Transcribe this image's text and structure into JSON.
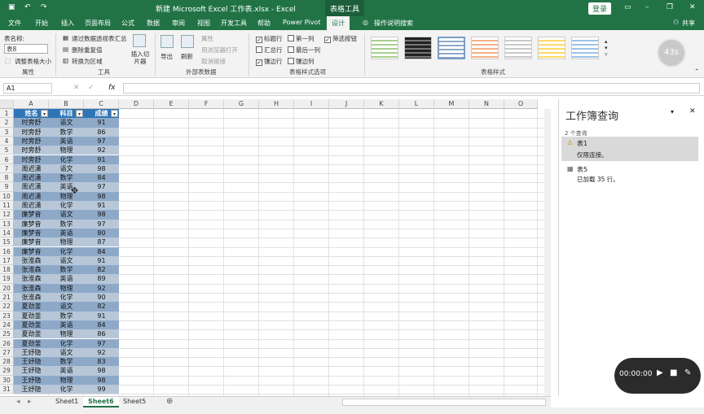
{
  "titlebar": {
    "title": "新建 Microsoft Excel 工作表.xlsx  -  Excel",
    "context": "表格工具",
    "login": "登录",
    "share": "共享"
  },
  "tabs": [
    "文件",
    "开始",
    "插入",
    "页面布局",
    "公式",
    "数据",
    "审阅",
    "视图",
    "开发工具",
    "帮助",
    "Power Pivot",
    "设计"
  ],
  "search_tab": "操作说明搜索",
  "ribbon": {
    "table_name_label": "表名称:",
    "table_name_value": "表8",
    "resize": "调整表格大小",
    "group_properties": "属性",
    "tools": [
      "通过数据透视表汇总",
      "删除重复值",
      "转换为区域"
    ],
    "insert_slicer": "插入切片器",
    "group_tools": "工具",
    "export": "导出",
    "refresh": "刷新",
    "ext_items": [
      "属性",
      "用浏览器打开",
      "取消链接"
    ],
    "group_external": "外部表数据",
    "options": [
      {
        "label": "标题行",
        "checked": true
      },
      {
        "label": "第一列",
        "checked": false
      },
      {
        "label": "筛选按钮",
        "checked": true
      },
      {
        "label": "汇总行",
        "checked": false
      },
      {
        "label": "最后一列",
        "checked": false
      },
      {
        "label": "镶边行",
        "checked": true
      },
      {
        "label": "镶边列",
        "checked": false
      }
    ],
    "group_options": "表格样式选项",
    "group_styles": "表格样式",
    "timer": "43s"
  },
  "formula": {
    "namebox": "A1",
    "fx": "fx"
  },
  "columns": [
    "A",
    "B",
    "C",
    "D",
    "E",
    "F",
    "G",
    "H",
    "I",
    "J",
    "K",
    "L",
    "M",
    "N",
    "O"
  ],
  "table": {
    "headers": [
      "姓名",
      "科目",
      "成绩"
    ],
    "rows": [
      [
        "时旁舒",
        "语文",
        "91"
      ],
      [
        "时旁舒",
        "数学",
        "86"
      ],
      [
        "时旁舒",
        "英语",
        "97"
      ],
      [
        "时旁舒",
        "物理",
        "92"
      ],
      [
        "时旁舒",
        "化学",
        "91"
      ],
      [
        "周迟潇",
        "语文",
        "98"
      ],
      [
        "周迟潇",
        "数学",
        "84"
      ],
      [
        "周迟潇",
        "英语",
        "97"
      ],
      [
        "周迟潇",
        "物理",
        "98"
      ],
      [
        "周迟潇",
        "化学",
        "91"
      ],
      [
        "廉梦音",
        "语文",
        "98"
      ],
      [
        "廉梦音",
        "数学",
        "97"
      ],
      [
        "廉梦音",
        "英语",
        "80"
      ],
      [
        "廉梦音",
        "物理",
        "87"
      ],
      [
        "廉梦音",
        "化学",
        "84"
      ],
      [
        "张淮森",
        "语文",
        "91"
      ],
      [
        "张淮森",
        "数学",
        "82"
      ],
      [
        "张淮森",
        "英语",
        "89"
      ],
      [
        "张淮森",
        "物理",
        "92"
      ],
      [
        "张淮森",
        "化学",
        "90"
      ],
      [
        "夏劲釜",
        "语文",
        "82"
      ],
      [
        "夏劲釜",
        "数学",
        "91"
      ],
      [
        "夏劲釜",
        "英语",
        "84"
      ],
      [
        "夏劲釜",
        "物理",
        "86"
      ],
      [
        "夏劲釜",
        "化学",
        "97"
      ],
      [
        "王妤隐",
        "语文",
        "92"
      ],
      [
        "王妤隐",
        "数学",
        "83"
      ],
      [
        "王妤隐",
        "英语",
        "98"
      ],
      [
        "王妤隐",
        "物理",
        "98"
      ],
      [
        "王妤隐",
        "化学",
        "99"
      ]
    ]
  },
  "panel": {
    "title": "工作簿查询",
    "count": "2 个查询",
    "queries": [
      {
        "name": "表1",
        "status": "仅限连接。"
      },
      {
        "name": "表5",
        "status": "已加载 35 行。"
      }
    ]
  },
  "sheets": [
    "Sheet1",
    "Sheet6",
    "Sheet5"
  ],
  "active_sheet": "Sheet6",
  "recorder": {
    "time": "00:00:00"
  }
}
